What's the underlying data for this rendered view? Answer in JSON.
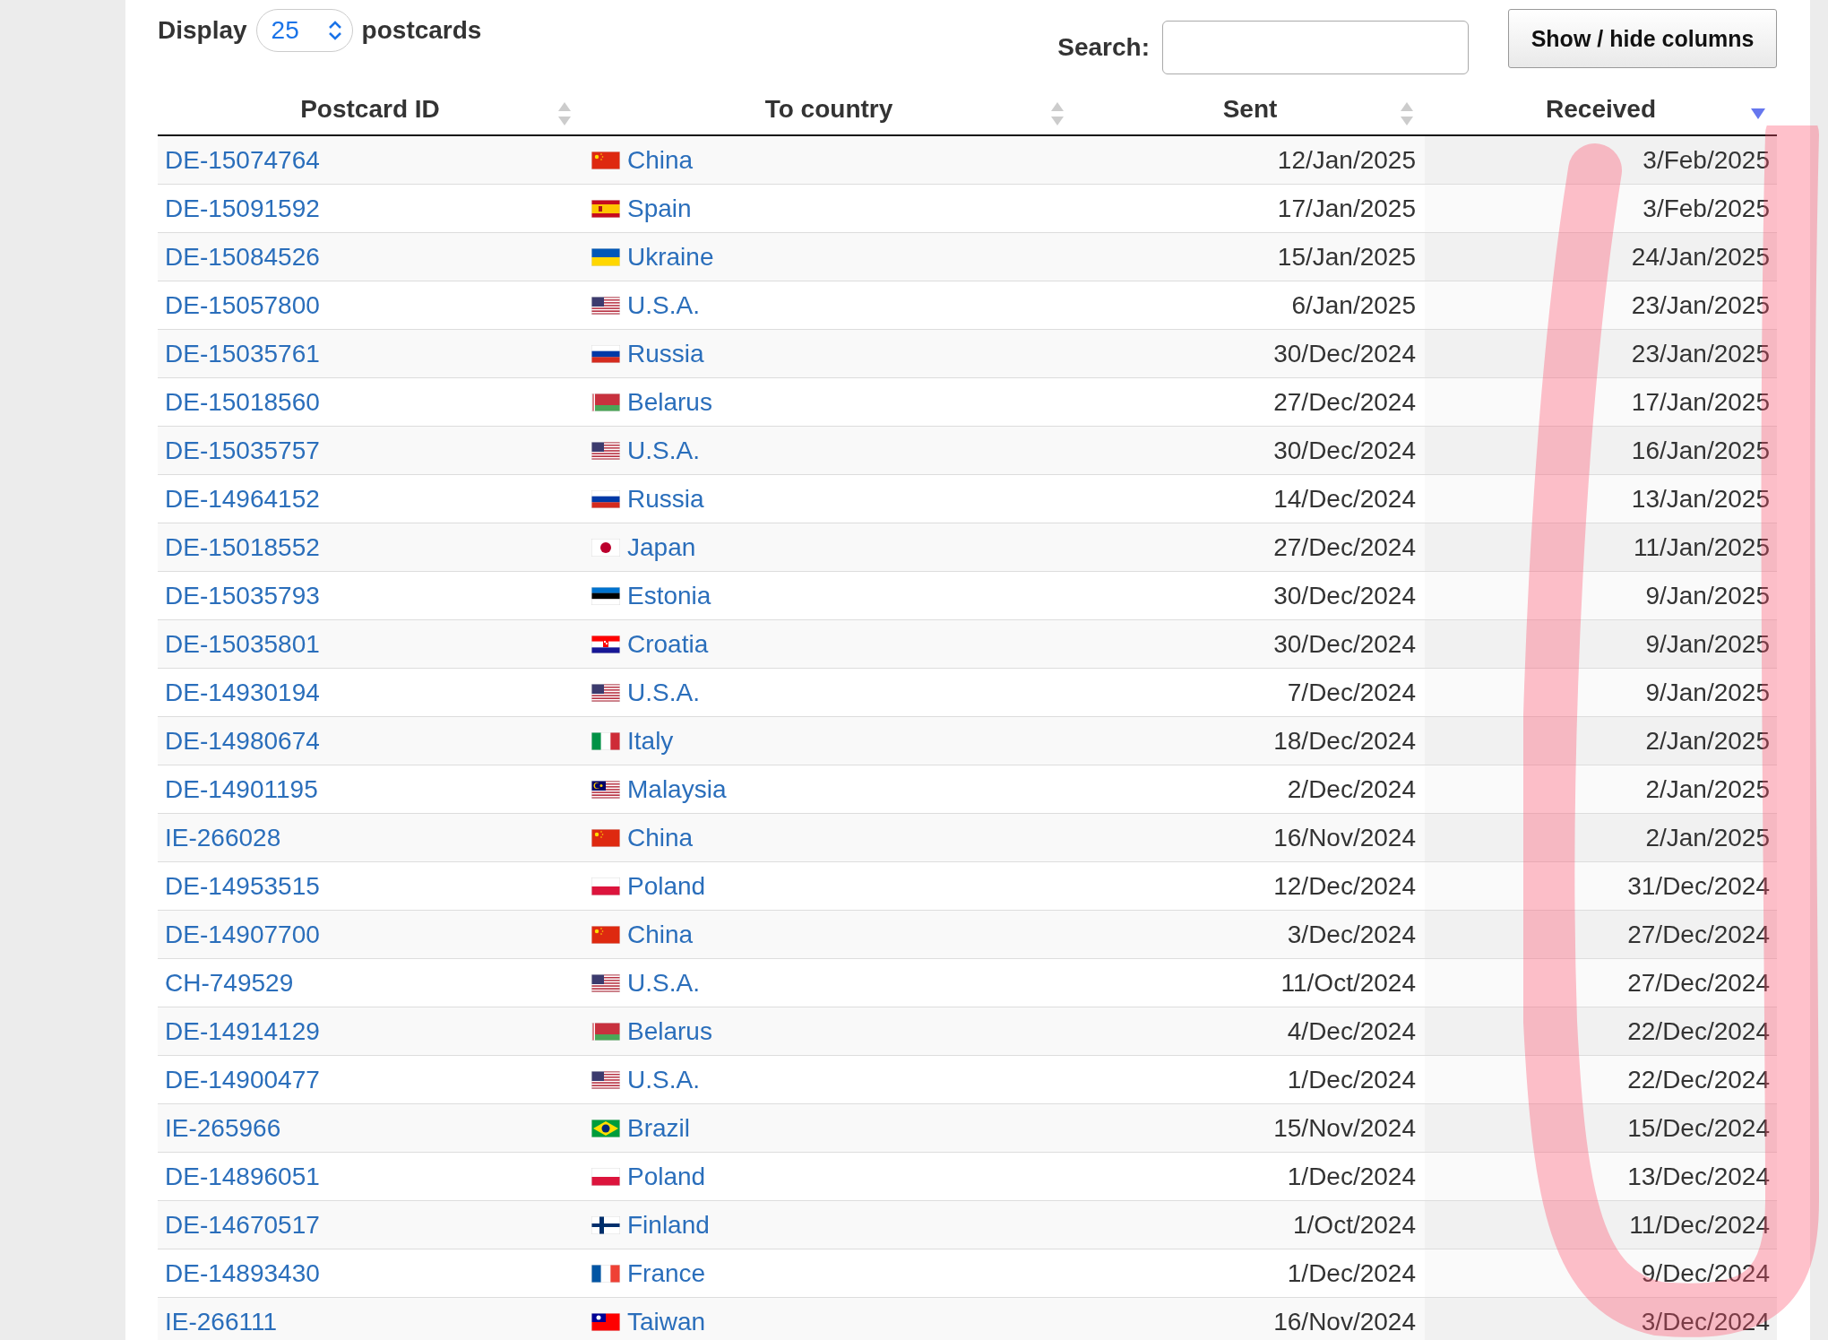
{
  "length_control": {
    "before": "Display",
    "value": "25",
    "after": "postcards"
  },
  "search": {
    "label": "Search:"
  },
  "columns_button": "Show / hide columns",
  "columns": [
    {
      "label": "Postcard ID",
      "sorted": false
    },
    {
      "label": "To country",
      "sorted": false
    },
    {
      "label": "Sent",
      "sorted": false
    },
    {
      "label": "Received",
      "sorted": true
    }
  ],
  "rows": [
    {
      "id": "DE-15074764",
      "kind": "cn",
      "country": "China",
      "sent": "12/Jan/2025",
      "received": "3/Feb/2025"
    },
    {
      "id": "DE-15091592",
      "kind": "es",
      "country": "Spain",
      "sent": "17/Jan/2025",
      "received": "3/Feb/2025"
    },
    {
      "id": "DE-15084526",
      "kind": "ua",
      "country": "Ukraine",
      "sent": "15/Jan/2025",
      "received": "24/Jan/2025"
    },
    {
      "id": "DE-15057800",
      "kind": "us",
      "country": "U.S.A.",
      "sent": "6/Jan/2025",
      "received": "23/Jan/2025"
    },
    {
      "id": "DE-15035761",
      "kind": "ru",
      "country": "Russia",
      "sent": "30/Dec/2024",
      "received": "23/Jan/2025"
    },
    {
      "id": "DE-15018560",
      "kind": "by",
      "country": "Belarus",
      "sent": "27/Dec/2024",
      "received": "17/Jan/2025"
    },
    {
      "id": "DE-15035757",
      "kind": "us",
      "country": "U.S.A.",
      "sent": "30/Dec/2024",
      "received": "16/Jan/2025"
    },
    {
      "id": "DE-14964152",
      "kind": "ru",
      "country": "Russia",
      "sent": "14/Dec/2024",
      "received": "13/Jan/2025"
    },
    {
      "id": "DE-15018552",
      "kind": "jp",
      "country": "Japan",
      "sent": "27/Dec/2024",
      "received": "11/Jan/2025"
    },
    {
      "id": "DE-15035793",
      "kind": "ee",
      "country": "Estonia",
      "sent": "30/Dec/2024",
      "received": "9/Jan/2025"
    },
    {
      "id": "DE-15035801",
      "kind": "hr",
      "country": "Croatia",
      "sent": "30/Dec/2024",
      "received": "9/Jan/2025"
    },
    {
      "id": "DE-14930194",
      "kind": "us",
      "country": "U.S.A.",
      "sent": "7/Dec/2024",
      "received": "9/Jan/2025"
    },
    {
      "id": "DE-14980674",
      "kind": "it",
      "country": "Italy",
      "sent": "18/Dec/2024",
      "received": "2/Jan/2025"
    },
    {
      "id": "DE-14901195",
      "kind": "my",
      "country": "Malaysia",
      "sent": "2/Dec/2024",
      "received": "2/Jan/2025"
    },
    {
      "id": "IE-266028",
      "kind": "cn",
      "country": "China",
      "sent": "16/Nov/2024",
      "received": "2/Jan/2025"
    },
    {
      "id": "DE-14953515",
      "kind": "pl",
      "country": "Poland",
      "sent": "12/Dec/2024",
      "received": "31/Dec/2024"
    },
    {
      "id": "DE-14907700",
      "kind": "cn",
      "country": "China",
      "sent": "3/Dec/2024",
      "received": "27/Dec/2024"
    },
    {
      "id": "CH-749529",
      "kind": "us",
      "country": "U.S.A.",
      "sent": "11/Oct/2024",
      "received": "27/Dec/2024"
    },
    {
      "id": "DE-14914129",
      "kind": "by",
      "country": "Belarus",
      "sent": "4/Dec/2024",
      "received": "22/Dec/2024"
    },
    {
      "id": "DE-14900477",
      "kind": "us",
      "country": "U.S.A.",
      "sent": "1/Dec/2024",
      "received": "22/Dec/2024"
    },
    {
      "id": "IE-265966",
      "kind": "br",
      "country": "Brazil",
      "sent": "15/Nov/2024",
      "received": "15/Dec/2024"
    },
    {
      "id": "DE-14896051",
      "kind": "pl",
      "country": "Poland",
      "sent": "1/Dec/2024",
      "received": "13/Dec/2024"
    },
    {
      "id": "DE-14670517",
      "kind": "fi",
      "country": "Finland",
      "sent": "1/Oct/2024",
      "received": "11/Dec/2024"
    },
    {
      "id": "DE-14893430",
      "kind": "fr",
      "country": "France",
      "sent": "1/Dec/2024",
      "received": "9/Dec/2024"
    },
    {
      "id": "IE-266111",
      "kind": "tw",
      "country": "Taiwan",
      "sent": "16/Nov/2024",
      "received": "3/Dec/2024"
    }
  ]
}
